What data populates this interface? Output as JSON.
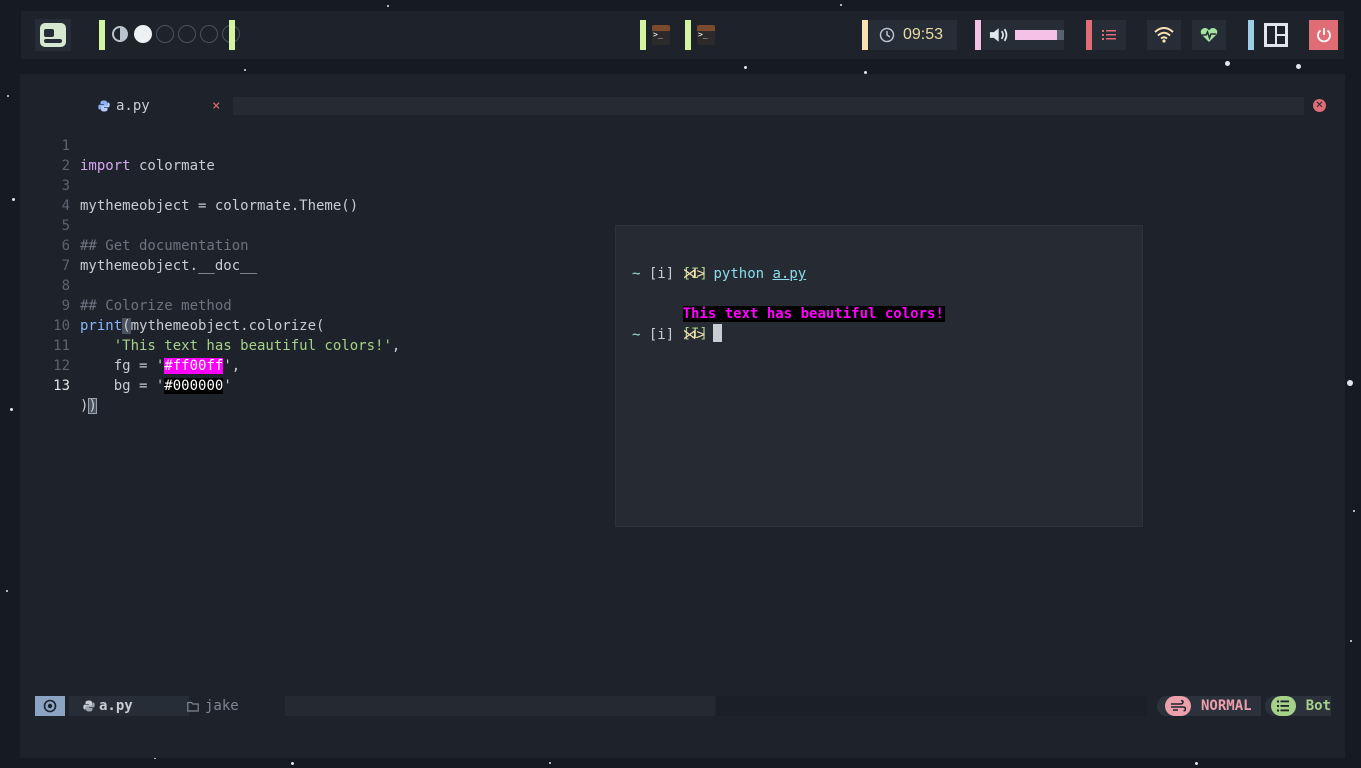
{
  "topbar": {
    "clock": "09:53",
    "volume_level": 0.86,
    "colors": {
      "green": "#d3f5a0",
      "yellow": "#f9e2af",
      "pink": "#f5c2e7",
      "red": "#e06c75",
      "blue": "#9ccfe6"
    }
  },
  "editor": {
    "tab": {
      "name": "a.py",
      "close": "×"
    },
    "lines": [
      {
        "num": "1",
        "text": "import colormate"
      },
      {
        "num": "2",
        "text": ""
      },
      {
        "num": "3",
        "text": "mythemeobject = colormate.Theme()"
      },
      {
        "num": "4",
        "text": ""
      },
      {
        "num": "5",
        "text": "## Get documentation"
      },
      {
        "num": "6",
        "text": "mythemeobject.__doc__"
      },
      {
        "num": "7",
        "text": ""
      },
      {
        "num": "8",
        "text": "## Colorize method"
      },
      {
        "num": "9",
        "text": "print(mythemeobject.colorize("
      },
      {
        "num": "10",
        "text": "    'This text has beautiful colors!',"
      },
      {
        "num": "11",
        "text": "    fg = '#ff00ff',"
      },
      {
        "num": "12",
        "text": "    bg = '#000000'"
      },
      {
        "num": "13",
        "text": "))"
      }
    ],
    "tokens": {
      "import": "import",
      "colormate": " colormate",
      "l3": "mythemeobject = colormate.Theme()",
      "l5": "## Get documentation",
      "l6": "mythemeobject.__doc__",
      "l8": "## Colorize method",
      "print": "print",
      "l9_open": "(",
      "l9_rest": "mythemeobject.colorize(",
      "l10": "'This text has beautiful colors!'",
      "l10_comma": ",",
      "fg_pre": "fg = '",
      "fg_val": "#ff00ff",
      "fg_post": "',",
      "bg_pre": "bg = '",
      "bg_val": "#000000",
      "bg_post": "'",
      "l13_a": ")",
      "l13_b": ")"
    }
  },
  "terminal": {
    "line1": "[I]",
    "prompt_tilde": "~",
    "prompt_mode": "[i]",
    "prompt_arrow": "⋊>",
    "cmd": "python",
    "arg": "a.py",
    "output": "This text has beautiful colors!",
    "line4": "[I]"
  },
  "statusline": {
    "file": "a.py",
    "dir": "jake",
    "mode": "NORMAL",
    "position": "Bot"
  }
}
